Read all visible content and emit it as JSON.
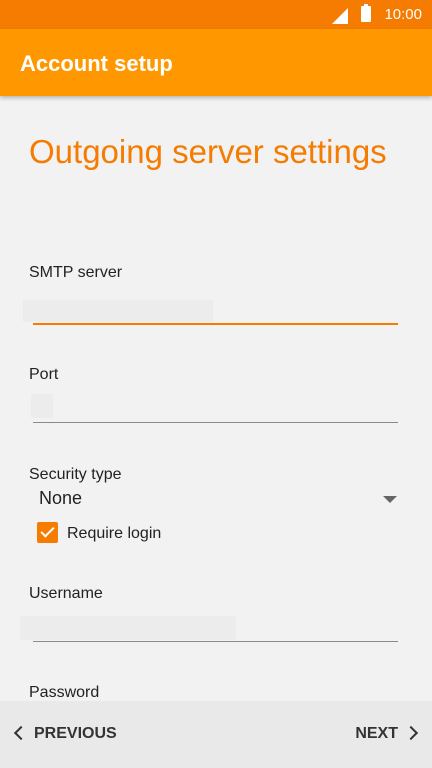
{
  "status_bar": {
    "time": "10:00",
    "signal_icon": "signal-icon",
    "battery_icon": "battery-icon"
  },
  "app_bar": {
    "title": "Account setup"
  },
  "page": {
    "title": "Outgoing server settings"
  },
  "fields": {
    "smtp_server": {
      "label": "SMTP server",
      "value": ""
    },
    "port": {
      "label": "Port",
      "value": ""
    },
    "security_type": {
      "label": "Security type",
      "value": "None"
    },
    "require_login": {
      "label": "Require login",
      "checked": true
    },
    "username": {
      "label": "Username",
      "value": ""
    },
    "password": {
      "label": "Password"
    }
  },
  "nav": {
    "previous": "PREVIOUS",
    "next": "NEXT"
  },
  "colors": {
    "status_bar": "#f57c00",
    "app_bar": "#ff9800",
    "accent": "#f57c00"
  }
}
